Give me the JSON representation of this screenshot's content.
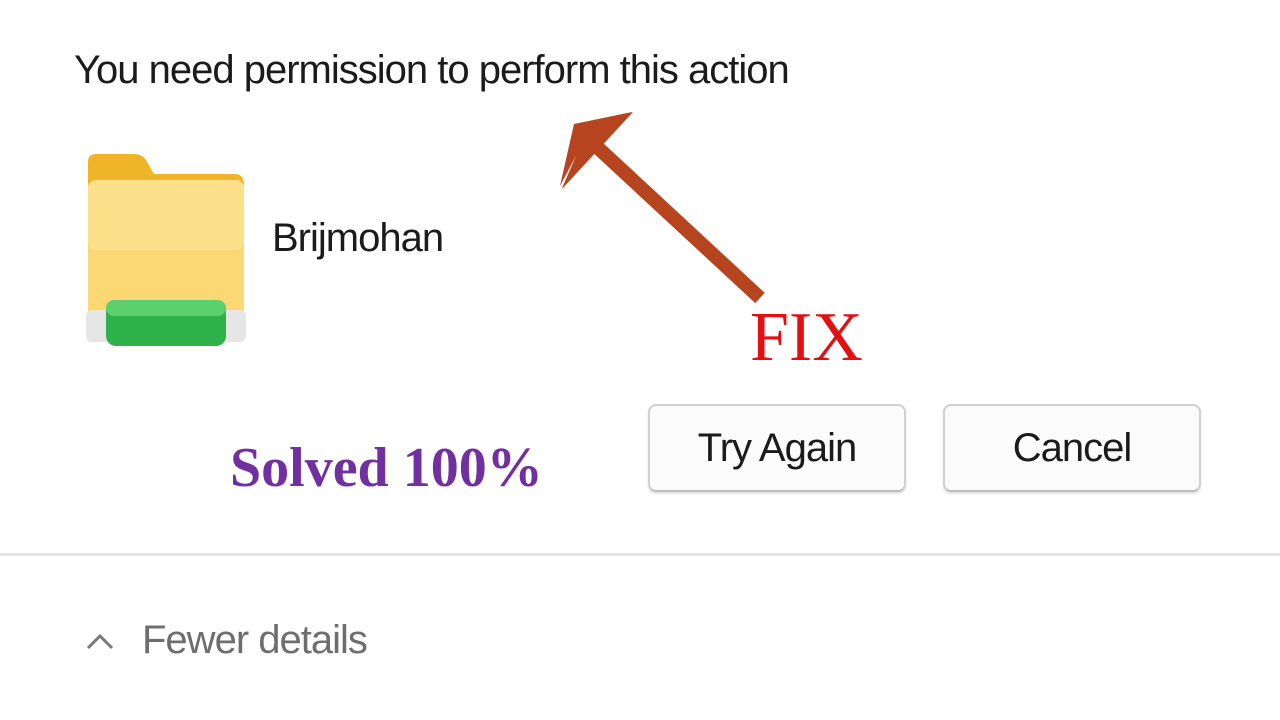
{
  "dialog": {
    "message": "You need permission to perform this action",
    "item_name": "Brijmohan",
    "buttons": {
      "try_again_label": "Try Again",
      "cancel_label": "Cancel"
    },
    "details_toggle_label": "Fewer details",
    "icons": {
      "item": "folder-icon",
      "details_toggle": "chevron-up-icon"
    }
  },
  "overlay": {
    "fix_text": "FIX",
    "solved_text": "Solved 100%",
    "colors": {
      "fix": "#e21010",
      "solved": "#7030a0",
      "arrow": "#b5441f"
    }
  }
}
